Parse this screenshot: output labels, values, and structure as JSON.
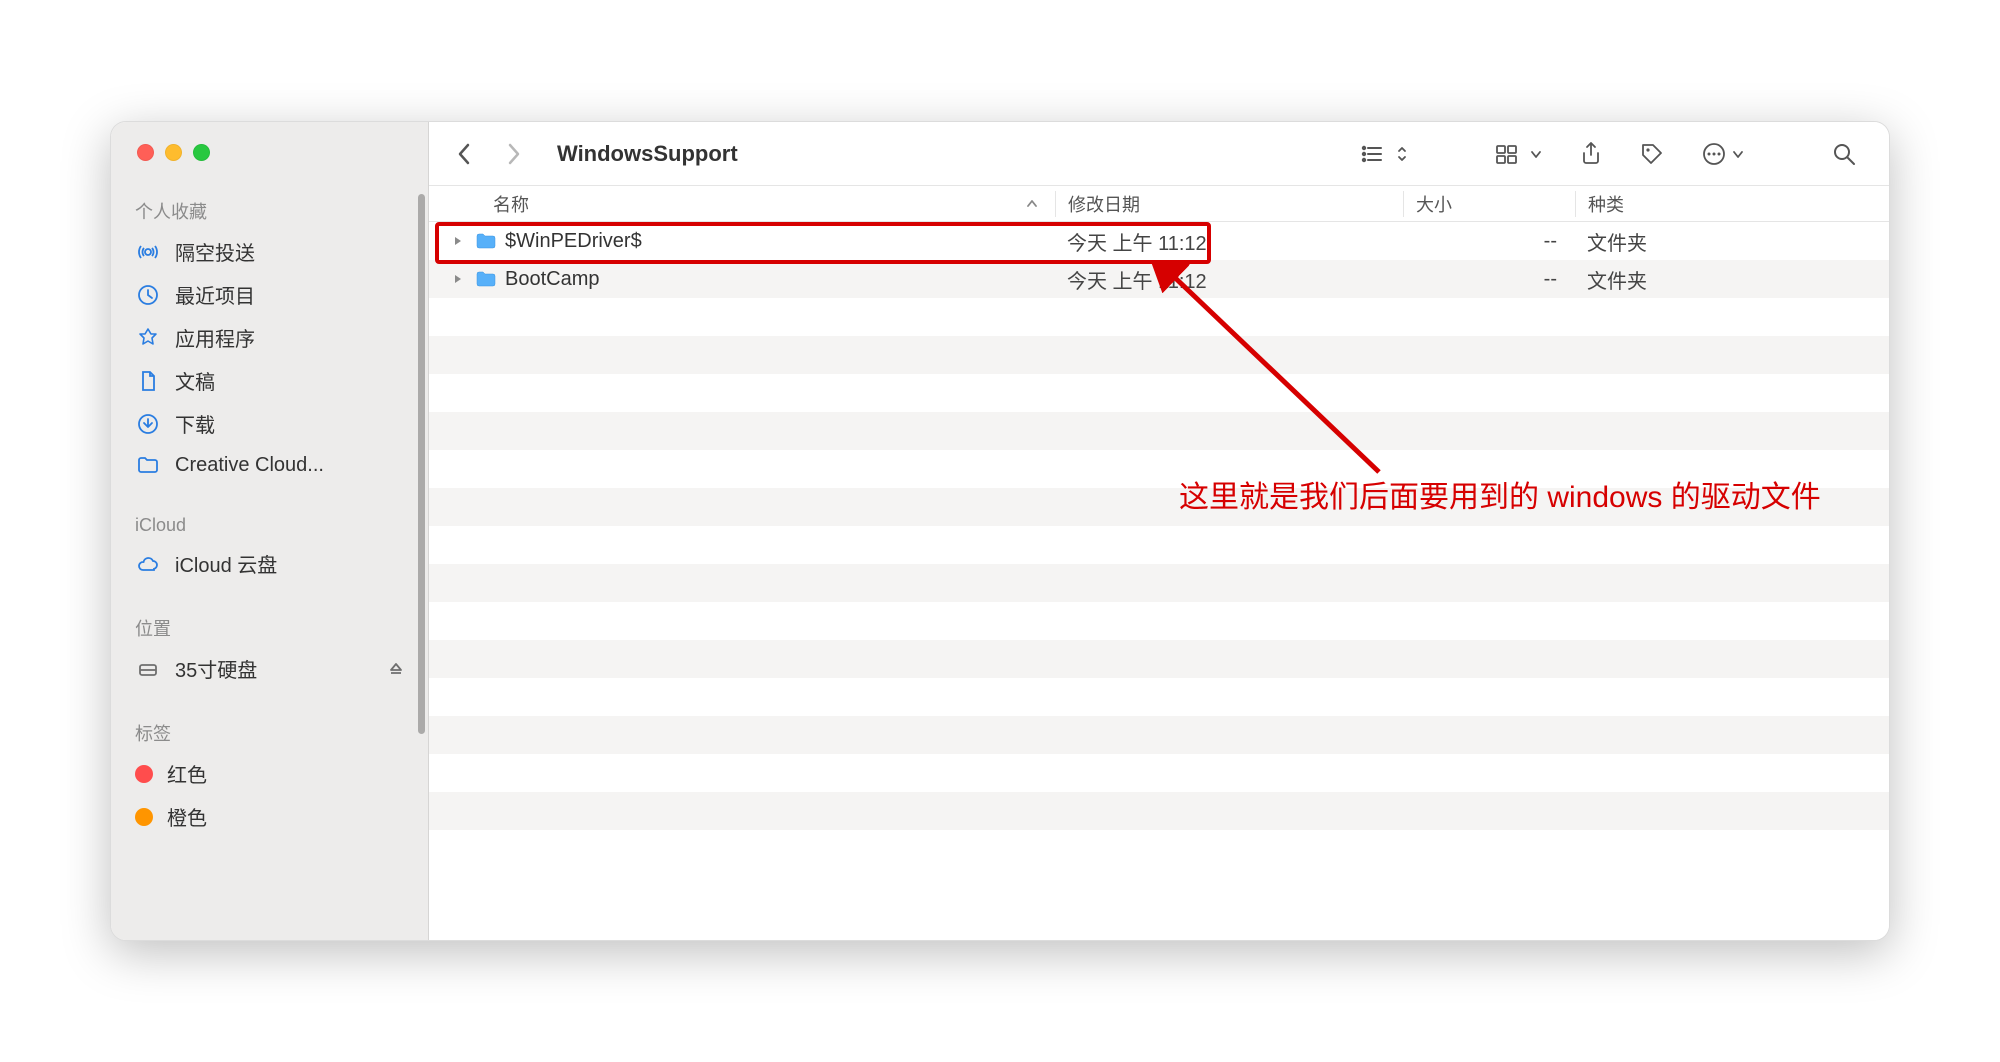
{
  "toolbar": {
    "title": "WindowsSupport"
  },
  "sidebar": {
    "section_favorites": "个人收藏",
    "favorites": [
      {
        "icon": "airdrop",
        "label": "隔空投送"
      },
      {
        "icon": "recent",
        "label": "最近项目"
      },
      {
        "icon": "apps",
        "label": "应用程序"
      },
      {
        "icon": "docs",
        "label": "文稿"
      },
      {
        "icon": "download",
        "label": "下载"
      },
      {
        "icon": "folder",
        "label": "Creative Cloud..."
      }
    ],
    "section_icloud": "iCloud",
    "icloud": [
      {
        "icon": "cloud",
        "label": "iCloud 云盘"
      }
    ],
    "section_locations": "位置",
    "locations": [
      {
        "icon": "disk",
        "label": "35寸硬盘",
        "eject": true
      }
    ],
    "section_tags": "标签",
    "tags": [
      {
        "color": "#ff4d4d",
        "label": "红色"
      },
      {
        "color": "#ff9500",
        "label": "橙色"
      }
    ]
  },
  "columns": {
    "name": "名称",
    "date": "修改日期",
    "size": "大小",
    "kind": "种类"
  },
  "files": [
    {
      "name": "$WinPEDriver$",
      "date": "今天 上午 11:12",
      "size": "--",
      "kind": "文件夹"
    },
    {
      "name": "BootCamp",
      "date": "今天 上午 11:12",
      "size": "--",
      "kind": "文件夹"
    }
  ],
  "annotation": "这里就是我们后面要用到的 windows 的驱动文件"
}
